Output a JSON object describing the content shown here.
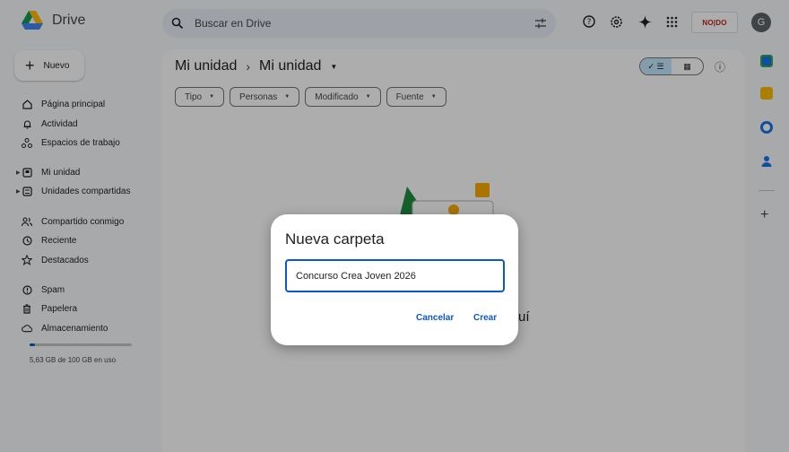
{
  "header": {
    "app_name": "Drive",
    "search_placeholder": "Buscar en Drive",
    "brand_badge": "NO|DO",
    "avatar_initial": "G"
  },
  "sidebar": {
    "new_label": "Nuevo",
    "items": [
      {
        "label": "Página principal",
        "icon": "home-icon"
      },
      {
        "label": "Actividad",
        "icon": "bell-icon"
      },
      {
        "label": "Espacios de trabajo",
        "icon": "workspaces-icon"
      },
      {
        "label": "Mi unidad",
        "icon": "my-drive-icon"
      },
      {
        "label": "Unidades compartidas",
        "icon": "shared-drives-icon"
      },
      {
        "label": "Compartido conmigo",
        "icon": "people-icon"
      },
      {
        "label": "Reciente",
        "icon": "clock-icon"
      },
      {
        "label": "Destacados",
        "icon": "star-icon"
      },
      {
        "label": "Spam",
        "icon": "spam-icon"
      },
      {
        "label": "Papelera",
        "icon": "trash-icon"
      },
      {
        "label": "Almacenamiento",
        "icon": "cloud-icon"
      }
    ],
    "storage_text": "5,63 GB de 100 GB en uso",
    "storage_fraction": 0.0563
  },
  "main": {
    "breadcrumb": [
      "Mi unidad",
      "Mi unidad"
    ],
    "filters": [
      "Tipo",
      "Personas",
      "Modificado",
      "Fuente"
    ],
    "empty_tail": "uí"
  },
  "dialog": {
    "title": "Nueva carpeta",
    "input_value": "Concurso Crea Joven 2026",
    "cancel_label": "Cancelar",
    "create_label": "Crear"
  },
  "colors": {
    "accent": "#0b57d0",
    "chip_on": "#c2e7ff"
  }
}
